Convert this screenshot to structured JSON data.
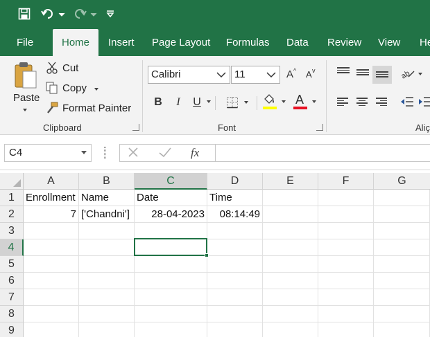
{
  "titlebar": {
    "quick_access": [
      "save-icon",
      "undo-icon",
      "redo-icon",
      "customize-icon"
    ]
  },
  "tabs": [
    {
      "label": "File",
      "active": false
    },
    {
      "label": "Home",
      "active": true
    },
    {
      "label": "Insert",
      "active": false
    },
    {
      "label": "Page Layout",
      "active": false
    },
    {
      "label": "Formulas",
      "active": false
    },
    {
      "label": "Data",
      "active": false
    },
    {
      "label": "Review",
      "active": false
    },
    {
      "label": "View",
      "active": false
    },
    {
      "label": "He",
      "active": false
    }
  ],
  "ribbon": {
    "clipboard": {
      "paste": "Paste",
      "cut": "Cut",
      "copy": "Copy",
      "format_painter": "Format Painter",
      "label": "Clipboard"
    },
    "font": {
      "name": "Calibri",
      "size": "11",
      "bold": "B",
      "italic": "I",
      "underline": "U",
      "font_color_glyph": "A",
      "grow_glyph": "A",
      "shrink_glyph": "A",
      "highlight_color": "#ffff00",
      "text_color": "#e81123",
      "label": "Font"
    },
    "alignment": {
      "label": "Aliç"
    }
  },
  "formula_bar": {
    "name_box": "C4",
    "fx": "fx",
    "formula": ""
  },
  "sheet": {
    "columns": [
      "A",
      "B",
      "C",
      "D",
      "E",
      "F",
      "G"
    ],
    "rows": [
      "1",
      "2",
      "3",
      "4",
      "5",
      "6",
      "7",
      "8",
      "9"
    ],
    "active_cell": "C4",
    "cells": {
      "A1": "Enrollment",
      "B1": "Name",
      "C1": "Date",
      "D1": "Time",
      "A2": "7",
      "B2": "['Chandni']",
      "C2": "28-04-2023",
      "D2": "08:14:49"
    }
  }
}
